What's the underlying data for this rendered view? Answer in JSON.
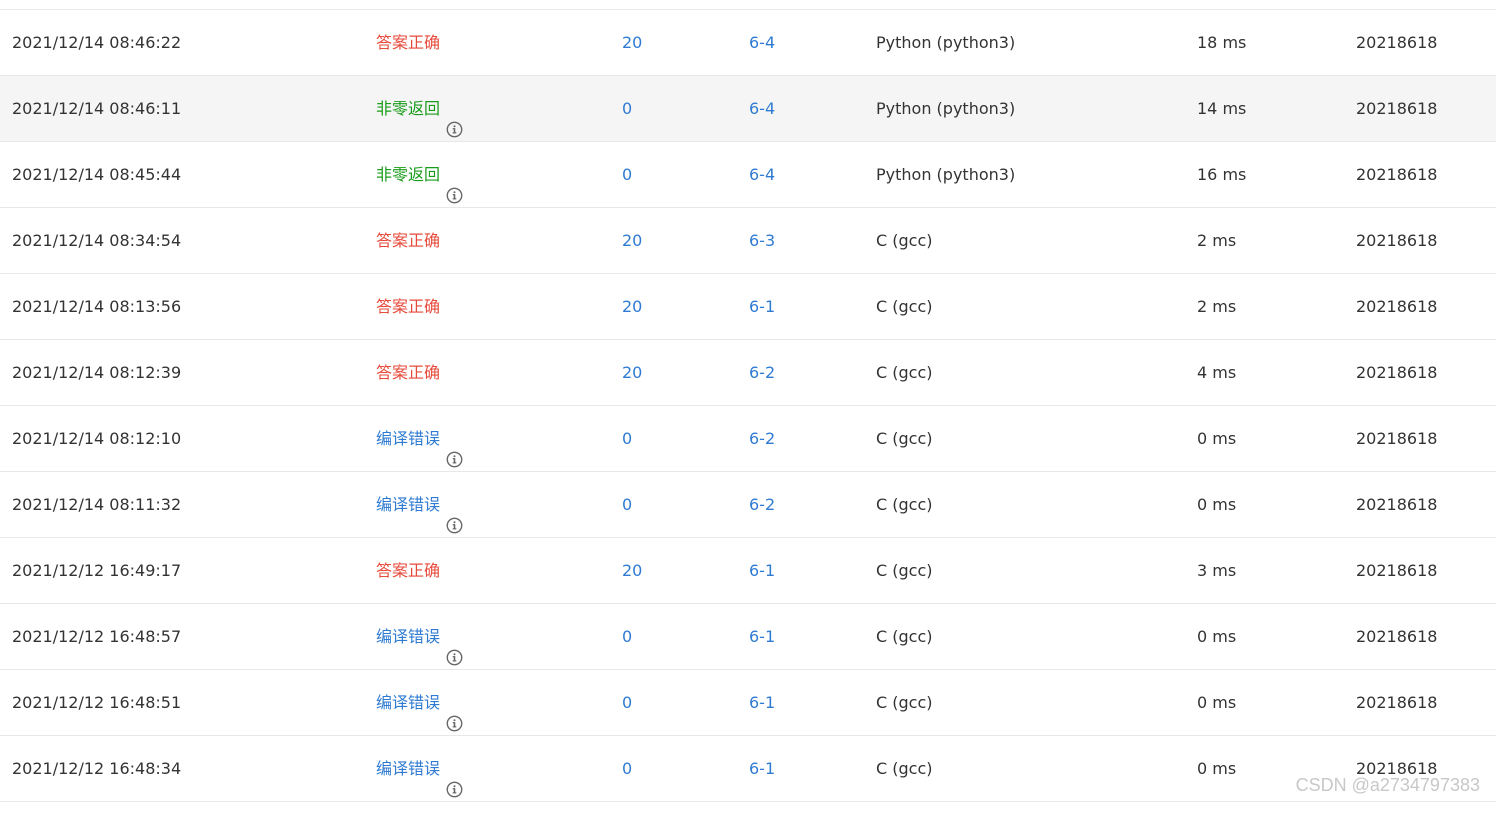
{
  "colors": {
    "accepted": "#e64a3b",
    "nonzero_return": "#1a9b1a",
    "compile_error": "#2f7bd2",
    "link": "#2f7bd2",
    "text": "#333333",
    "row_hover": "#f5f5f5",
    "border": "#e8e8e8"
  },
  "rows": [
    {
      "time": "2021/12/14 08:46:22",
      "status": "答案正确",
      "status_type": "accepted",
      "info": false,
      "score": "20",
      "problem": "6-4",
      "language": "Python (python3)",
      "runtime": "18 ms",
      "user": "20218618",
      "hover": false
    },
    {
      "time": "2021/12/14 08:46:11",
      "status": "非零返回",
      "status_type": "nonzero",
      "info": true,
      "score": "0",
      "problem": "6-4",
      "language": "Python (python3)",
      "runtime": "14 ms",
      "user": "20218618",
      "hover": true
    },
    {
      "time": "2021/12/14 08:45:44",
      "status": "非零返回",
      "status_type": "nonzero",
      "info": true,
      "score": "0",
      "problem": "6-4",
      "language": "Python (python3)",
      "runtime": "16 ms",
      "user": "20218618",
      "hover": false
    },
    {
      "time": "2021/12/14 08:34:54",
      "status": "答案正确",
      "status_type": "accepted",
      "info": false,
      "score": "20",
      "problem": "6-3",
      "language": "C (gcc)",
      "runtime": "2 ms",
      "user": "20218618",
      "hover": false
    },
    {
      "time": "2021/12/14 08:13:56",
      "status": "答案正确",
      "status_type": "accepted",
      "info": false,
      "score": "20",
      "problem": "6-1",
      "language": "C (gcc)",
      "runtime": "2 ms",
      "user": "20218618",
      "hover": false
    },
    {
      "time": "2021/12/14 08:12:39",
      "status": "答案正确",
      "status_type": "accepted",
      "info": false,
      "score": "20",
      "problem": "6-2",
      "language": "C (gcc)",
      "runtime": "4 ms",
      "user": "20218618",
      "hover": false
    },
    {
      "time": "2021/12/14 08:12:10",
      "status": "编译错误",
      "status_type": "compile",
      "info": true,
      "score": "0",
      "problem": "6-2",
      "language": "C (gcc)",
      "runtime": "0 ms",
      "user": "20218618",
      "hover": false
    },
    {
      "time": "2021/12/14 08:11:32",
      "status": "编译错误",
      "status_type": "compile",
      "info": true,
      "score": "0",
      "problem": "6-2",
      "language": "C (gcc)",
      "runtime": "0 ms",
      "user": "20218618",
      "hover": false
    },
    {
      "time": "2021/12/12 16:49:17",
      "status": "答案正确",
      "status_type": "accepted",
      "info": false,
      "score": "20",
      "problem": "6-1",
      "language": "C (gcc)",
      "runtime": "3 ms",
      "user": "20218618",
      "hover": false
    },
    {
      "time": "2021/12/12 16:48:57",
      "status": "编译错误",
      "status_type": "compile",
      "info": true,
      "score": "0",
      "problem": "6-1",
      "language": "C (gcc)",
      "runtime": "0 ms",
      "user": "20218618",
      "hover": false
    },
    {
      "time": "2021/12/12 16:48:51",
      "status": "编译错误",
      "status_type": "compile",
      "info": true,
      "score": "0",
      "problem": "6-1",
      "language": "C (gcc)",
      "runtime": "0 ms",
      "user": "20218618",
      "hover": false
    },
    {
      "time": "2021/12/12 16:48:34",
      "status": "编译错误",
      "status_type": "compile",
      "info": true,
      "score": "0",
      "problem": "6-1",
      "language": "C (gcc)",
      "runtime": "0 ms",
      "user": "20218618",
      "hover": false
    }
  ],
  "watermark": "CSDN @a2734797383",
  "icons": {
    "info": "info-circle-icon"
  }
}
